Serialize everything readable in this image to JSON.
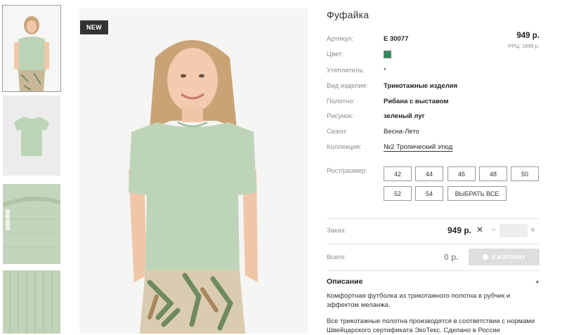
{
  "badge": "NEW",
  "product": {
    "title": "Фуфайка",
    "price": "949 р.",
    "rrp": "РРЦ: 1899 р.",
    "color": "#2e8b57"
  },
  "attributes": [
    {
      "label": "Артикул:",
      "value": "Е 30077"
    },
    {
      "label": "Цвет:",
      "value": ""
    },
    {
      "label": "Утеплитель:",
      "value": "*"
    },
    {
      "label": "Вид изделия:",
      "value": "Трикотажные изделия"
    },
    {
      "label": "Полотно:",
      "value": "Рибана с выставом"
    },
    {
      "label": "Рисунок:",
      "value": "зеленый луг"
    },
    {
      "label": "Сезон:",
      "value": "Весна-Лето"
    },
    {
      "label": "Коллекция:",
      "value": "№2 Тропический этюд"
    }
  ],
  "sizes": {
    "label": "Рост/размер:",
    "options": [
      "42",
      "44",
      "46",
      "48",
      "50",
      "52",
      "54"
    ],
    "select_all": "ВЫБРАТЬ ВСЕ"
  },
  "order": {
    "label": "Заказ:",
    "price": "949 р.",
    "times": "✕",
    "minus": "−",
    "plus": "+",
    "quantity": ""
  },
  "total": {
    "label": "Всего:",
    "value": "0 р.",
    "cart_button": "В КОРЗИНУ"
  },
  "description": {
    "title": "Описание",
    "caret": "▲",
    "paragraphs": [
      "Комфортная футболка из трикотажного полотна в рубчик и эффектом меланжа.",
      "Все трикотажные полотна производятся в соответствии с нормами Швейцарского сертификата ЭкоТекс. Сделано в России"
    ]
  }
}
